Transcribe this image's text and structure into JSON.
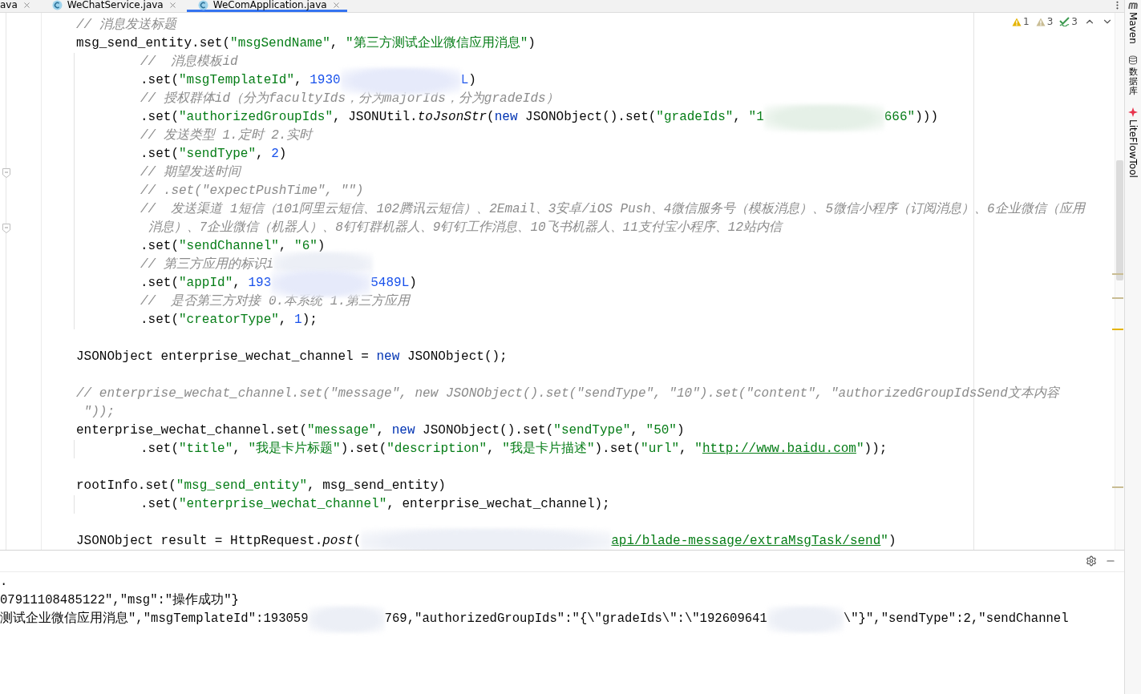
{
  "tabs": [
    {
      "label": "ava",
      "selected": false,
      "icon": false
    },
    {
      "label": "WeChatService.java",
      "selected": false,
      "icon": true
    },
    {
      "label": "WeComApplication.java",
      "selected": true,
      "icon": true
    }
  ],
  "inspections": [
    {
      "kind": "warning",
      "count": "1"
    },
    {
      "kind": "weak-warning",
      "count": "3"
    },
    {
      "kind": "typo",
      "count": "3"
    }
  ],
  "code_lines": [
    {
      "kind": "code",
      "fold": false,
      "tokens": [
        {
          "kind": "cmt",
          "text": "// 消息发送标题"
        }
      ]
    },
    {
      "kind": "code",
      "fold": false,
      "tokens": [
        {
          "kind": "plain",
          "text": "msg_send_entity.set("
        },
        {
          "kind": "str",
          "text": "\"msgSendName\""
        },
        {
          "kind": "plain",
          "text": ", "
        },
        {
          "kind": "str",
          "text": "\"第三方测试企业微信应用消息\""
        },
        {
          "kind": "plain",
          "text": ")"
        }
      ],
      "children": [
        {
          "kind": "code",
          "fold": false,
          "tokens": [
            {
              "kind": "cmt",
              "text": "//  消息模板id"
            }
          ]
        },
        {
          "kind": "code",
          "fold": false,
          "tokens": [
            {
              "kind": "plain",
              "text": ".set("
            },
            {
              "kind": "str",
              "text": "\"msgTemplateId\""
            },
            {
              "kind": "plain",
              "text": ", "
            },
            {
              "kind": "num",
              "text": "1930"
            },
            {
              "kind": "blur"
            },
            {
              "kind": "num",
              "text": "L"
            },
            {
              "kind": "plain",
              "text": ")"
            }
          ]
        },
        {
          "kind": "code",
          "fold": false,
          "tokens": [
            {
              "kind": "cmt",
              "text": "// 授权群体id（分为facultyIds，分为majorIds，分为gradeIds）"
            }
          ]
        },
        {
          "kind": "code",
          "fold": false,
          "tokens": [
            {
              "kind": "plain",
              "text": ".set("
            },
            {
              "kind": "str",
              "text": "\"authorizedGroupIds\""
            },
            {
              "kind": "plain",
              "text": ", JSONUtil."
            },
            {
              "kind": "it",
              "text": "toJsonStr"
            },
            {
              "kind": "plain",
              "text": "("
            },
            {
              "kind": "kw",
              "text": "new"
            },
            {
              "kind": "plain",
              "text": " JSONObject().set("
            },
            {
              "kind": "str",
              "text": "\"gradeIds\""
            },
            {
              "kind": "plain",
              "text": ", "
            },
            {
              "kind": "str",
              "text": "\"1"
            },
            {
              "kind": "blur"
            },
            {
              "kind": "str",
              "text": "666\""
            },
            {
              "kind": "plain",
              "text": ")))"
            }
          ]
        },
        {
          "kind": "code",
          "fold": false,
          "tokens": [
            {
              "kind": "cmt",
              "text": "// 发送类型 1.定时 2.实时"
            }
          ]
        },
        {
          "kind": "code",
          "fold": false,
          "tokens": [
            {
              "kind": "plain",
              "text": ".set("
            },
            {
              "kind": "str",
              "text": "\"sendType\""
            },
            {
              "kind": "plain",
              "text": ", "
            },
            {
              "kind": "num",
              "text": "2"
            },
            {
              "kind": "plain",
              "text": ")"
            }
          ]
        },
        {
          "kind": "code",
          "fold": true,
          "tokens": [
            {
              "kind": "cmt",
              "text": "// 期望发送时间"
            }
          ]
        },
        {
          "kind": "code",
          "fold": false,
          "tokens": [
            {
              "kind": "cmt",
              "text": "// .set(\"expectPushTime\", \"\")"
            }
          ]
        },
        {
          "kind": "code",
          "fold": false,
          "tokens": [
            {
              "kind": "cmt",
              "text": "//  发送渠道 1短信（101阿里云短信、102腾讯云短信）、2Email、3安卓/iOS Push、4微信服务号（模板消息）、5微信小程序（订阅消息）、6企业微信（应用"
            }
          ]
        },
        {
          "kind": "code",
          "fold": true,
          "tokens": [
            {
              "kind": "cmt",
              "text": " 消息）、7企业微信（机器人）、8钉钉群机器人、9钉钉工作消息、10飞书机器人、11支付宝小程序、12站内信"
            }
          ]
        },
        {
          "kind": "code",
          "fold": false,
          "tokens": [
            {
              "kind": "plain",
              "text": ".set("
            },
            {
              "kind": "str",
              "text": "\"sendChannel\""
            },
            {
              "kind": "plain",
              "text": ", "
            },
            {
              "kind": "str",
              "text": "\"6\""
            },
            {
              "kind": "plain",
              "text": ")"
            }
          ]
        },
        {
          "kind": "code",
          "fold": false,
          "tokens": [
            {
              "kind": "cmt",
              "text": "// 第三方应用的标识i"
            },
            {
              "kind": "blur-narrow"
            }
          ]
        },
        {
          "kind": "code",
          "fold": false,
          "tokens": [
            {
              "kind": "plain",
              "text": ".set("
            },
            {
              "kind": "str",
              "text": "\"appId\""
            },
            {
              "kind": "plain",
              "text": ", "
            },
            {
              "kind": "num",
              "text": "193"
            },
            {
              "kind": "blur-narrow"
            },
            {
              "kind": "num",
              "text": "5489L"
            },
            {
              "kind": "plain",
              "text": ")"
            }
          ]
        },
        {
          "kind": "code",
          "fold": false,
          "tokens": [
            {
              "kind": "cmt",
              "text": "//  是否第三方对接 0.本系统 1.第三方应用"
            }
          ]
        },
        {
          "kind": "code",
          "fold": false,
          "tokens": [
            {
              "kind": "plain",
              "text": ".set("
            },
            {
              "kind": "str",
              "text": "\"creatorType\""
            },
            {
              "kind": "plain",
              "text": ", "
            },
            {
              "kind": "num",
              "text": "1"
            },
            {
              "kind": "plain",
              "text": ");"
            }
          ]
        }
      ]
    },
    {
      "kind": "blank",
      "fold": false
    },
    {
      "kind": "code",
      "fold": false,
      "tokens": [
        {
          "kind": "plain",
          "text": "JSONObject enterprise_wechat_channel = "
        },
        {
          "kind": "kw",
          "text": "new"
        },
        {
          "kind": "plain",
          "text": " JSONObject();"
        }
      ]
    },
    {
      "kind": "blank",
      "fold": false
    },
    {
      "kind": "code",
      "fold": false,
      "tokens": [
        {
          "kind": "cmt",
          "text": "// enterprise_wechat_channel.set(\"message\", new JSONObject().set(\"sendType\", \"10\").set(\"content\", \"authorizedGroupIdsSend文本内容"
        }
      ]
    },
    {
      "kind": "code",
      "fold": false,
      "tokens": [
        {
          "kind": "cmt",
          "text": " \"));"
        }
      ]
    },
    {
      "kind": "code",
      "fold": false,
      "tokens": [
        {
          "kind": "plain",
          "text": "enterprise_wechat_channel.set("
        },
        {
          "kind": "str",
          "text": "\"message\""
        },
        {
          "kind": "plain",
          "text": ", "
        },
        {
          "kind": "kw",
          "text": "new"
        },
        {
          "kind": "plain",
          "text": " JSONObject().set("
        },
        {
          "kind": "str",
          "text": "\"sendType\""
        },
        {
          "kind": "plain",
          "text": ", "
        },
        {
          "kind": "str",
          "text": "\"50\""
        },
        {
          "kind": "plain",
          "text": ")"
        }
      ],
      "children": [
        {
          "kind": "code",
          "fold": false,
          "tokens": [
            {
              "kind": "plain",
              "text": ".set("
            },
            {
              "kind": "str",
              "text": "\"title\""
            },
            {
              "kind": "plain",
              "text": ", "
            },
            {
              "kind": "str",
              "text": "\"我是卡片标题\""
            },
            {
              "kind": "plain",
              "text": ").set("
            },
            {
              "kind": "str",
              "text": "\"description\""
            },
            {
              "kind": "plain",
              "text": ", "
            },
            {
              "kind": "str",
              "text": "\"我是卡片描述\""
            },
            {
              "kind": "plain",
              "text": ").set("
            },
            {
              "kind": "str",
              "text": "\"url\""
            },
            {
              "kind": "plain",
              "text": ", "
            },
            {
              "kind": "str",
              "text": "\""
            },
            {
              "kind": "link",
              "text": "http://www.baidu.com"
            },
            {
              "kind": "str",
              "text": "\""
            },
            {
              "kind": "plain",
              "text": "));"
            }
          ]
        }
      ]
    },
    {
      "kind": "blank",
      "fold": false
    },
    {
      "kind": "code",
      "fold": false,
      "tokens": [
        {
          "kind": "plain",
          "text": "rootInfo.set("
        },
        {
          "kind": "str",
          "text": "\"msg_send_entity\""
        },
        {
          "kind": "plain",
          "text": ", msg_send_entity)"
        }
      ],
      "children": [
        {
          "kind": "code",
          "fold": false,
          "tokens": [
            {
              "kind": "plain",
              "text": ".set("
            },
            {
              "kind": "str",
              "text": "\"enterprise_wechat_channel\""
            },
            {
              "kind": "plain",
              "text": ", enterprise_wechat_channel);"
            }
          ]
        }
      ]
    },
    {
      "kind": "blank",
      "fold": false
    },
    {
      "kind": "code",
      "fold": false,
      "tokens": [
        {
          "kind": "plain",
          "text": "JSONObject result = HttpRequest."
        },
        {
          "kind": "it",
          "text": "post"
        },
        {
          "kind": "plain",
          "text": "("
        },
        {
          "kind": "blur-wide"
        },
        {
          "kind": "link",
          "text": "api/blade-message/extraMsgTask/send"
        },
        {
          "kind": "str",
          "text": "\""
        },
        {
          "kind": "plain",
          "text": ")"
        }
      ]
    }
  ],
  "console_lines": [
    {
      "tokens": [
        {
          "kind": "plain",
          "text": "."
        }
      ]
    },
    {
      "tokens": [
        {
          "kind": "plain",
          "text": "07911108485122\",\"msg\":\"操作成功\"}"
        }
      ]
    },
    {
      "tokens": [
        {
          "kind": "plain",
          "text": "测试企业微信应用消息\",\"msgTemplateId\":193059"
        },
        {
          "kind": "blur-small"
        },
        {
          "kind": "plain",
          "text": "769,\"authorizedGroupIds\":\"{\\\"gradeIds\\\":\\\"192609641"
        },
        {
          "kind": "blur-small"
        },
        {
          "kind": "plain",
          "text": "\\\"}\",\"sendType\":2,\"sendChannel"
        }
      ]
    }
  ],
  "tool_windows": [
    {
      "kind": "maven",
      "label": "Maven"
    },
    {
      "kind": "database",
      "label": "数据库"
    },
    {
      "kind": "liteflow",
      "label": "LiteFlowTool"
    }
  ]
}
